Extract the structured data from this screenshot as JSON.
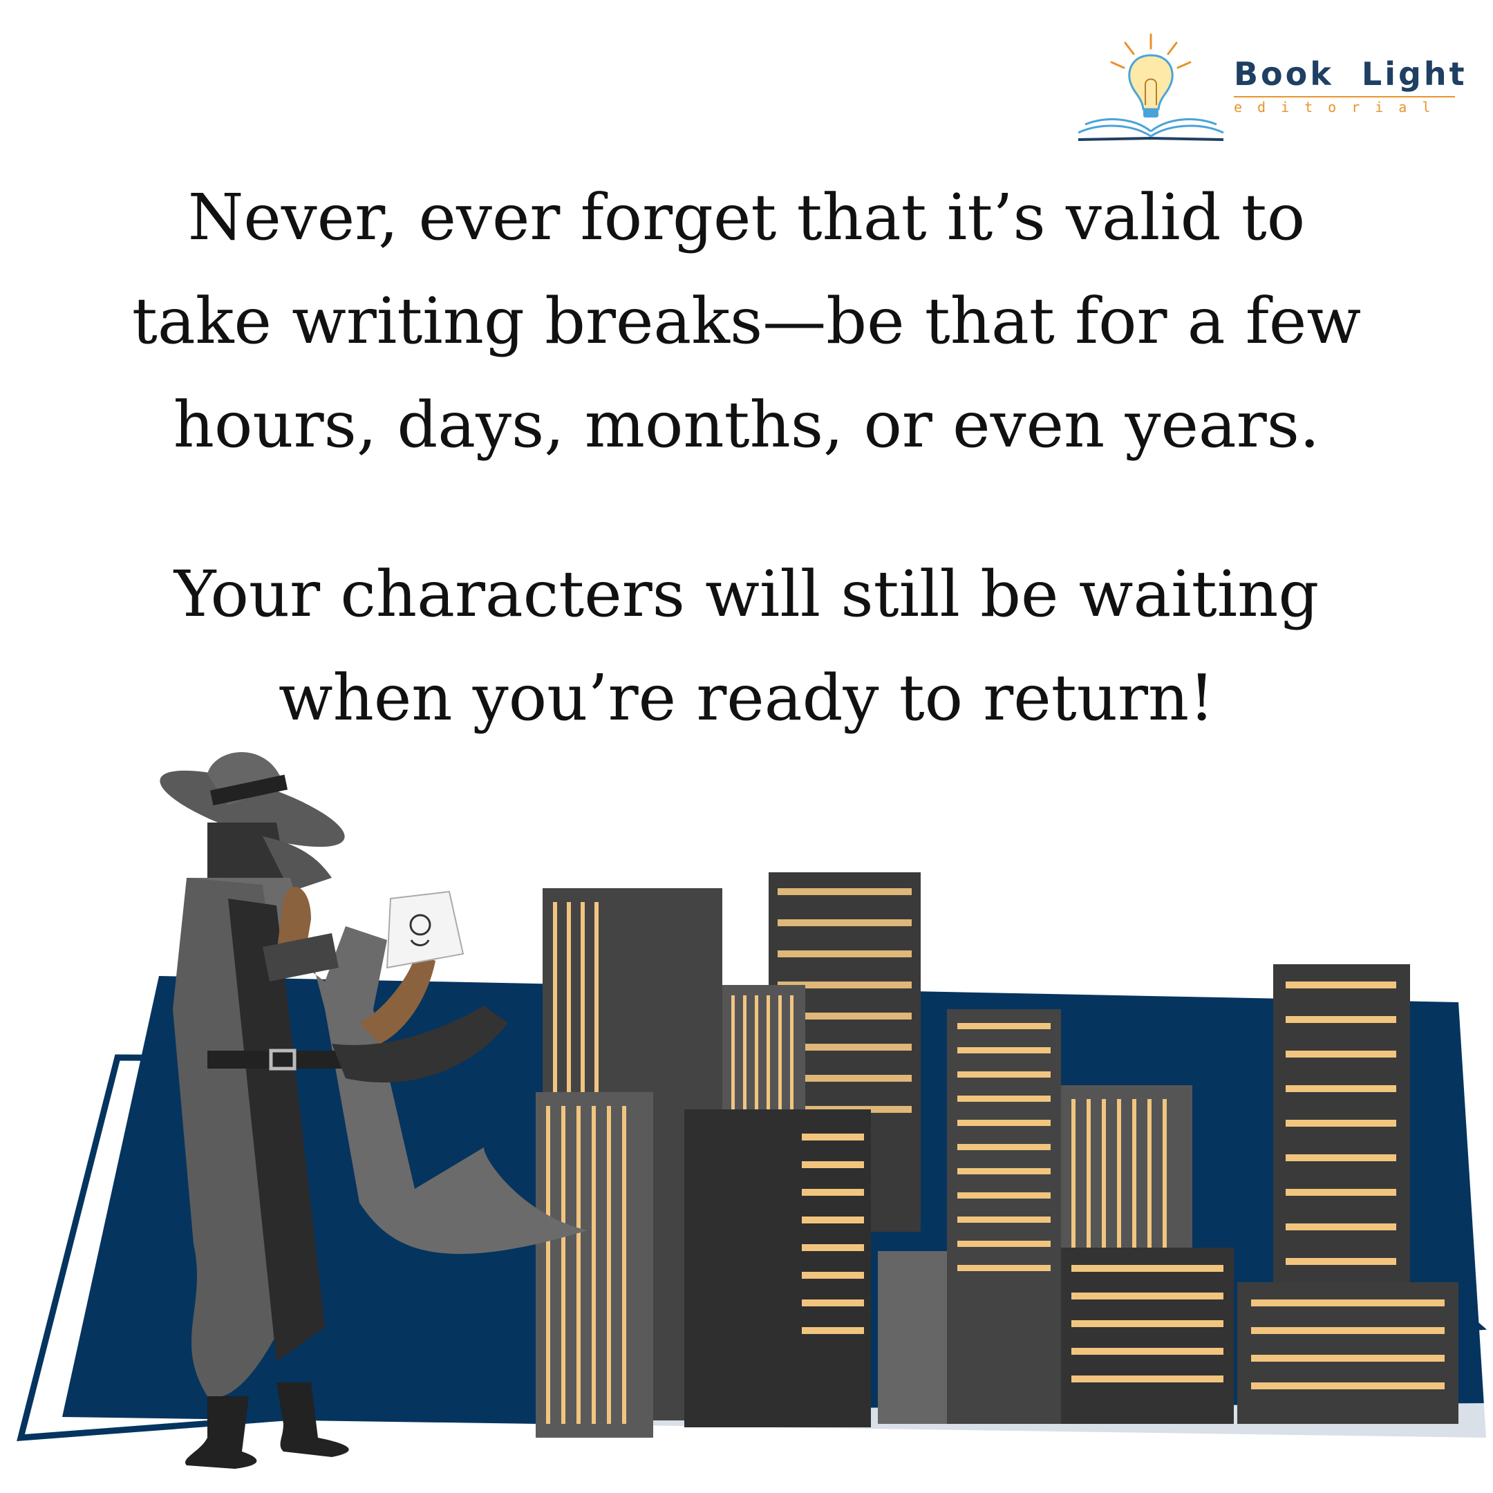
{
  "brand": {
    "name": "Book  Light",
    "subtitle": "editorial",
    "colors": {
      "navy": "#1f3f63",
      "orange": "#e8932a",
      "sky": "#4aa3d8"
    }
  },
  "quote": {
    "paragraph1": [
      "Never, ever forget that it’s valid to",
      "take writing breaks—be that for a few",
      "hours, days, months, or even years."
    ],
    "paragraph2": [
      "Your characters will still be waiting",
      "when you’re ready to return!"
    ]
  },
  "illustration": {
    "subject": "detective-in-trench-coat-holding-sketch",
    "scene": "night-city-skyline-popping-out-of-open-book",
    "colors": {
      "page": "#05345f",
      "window": "#f2c57f",
      "building": "#5a5a5a",
      "coat": "#6b6b6b"
    }
  }
}
